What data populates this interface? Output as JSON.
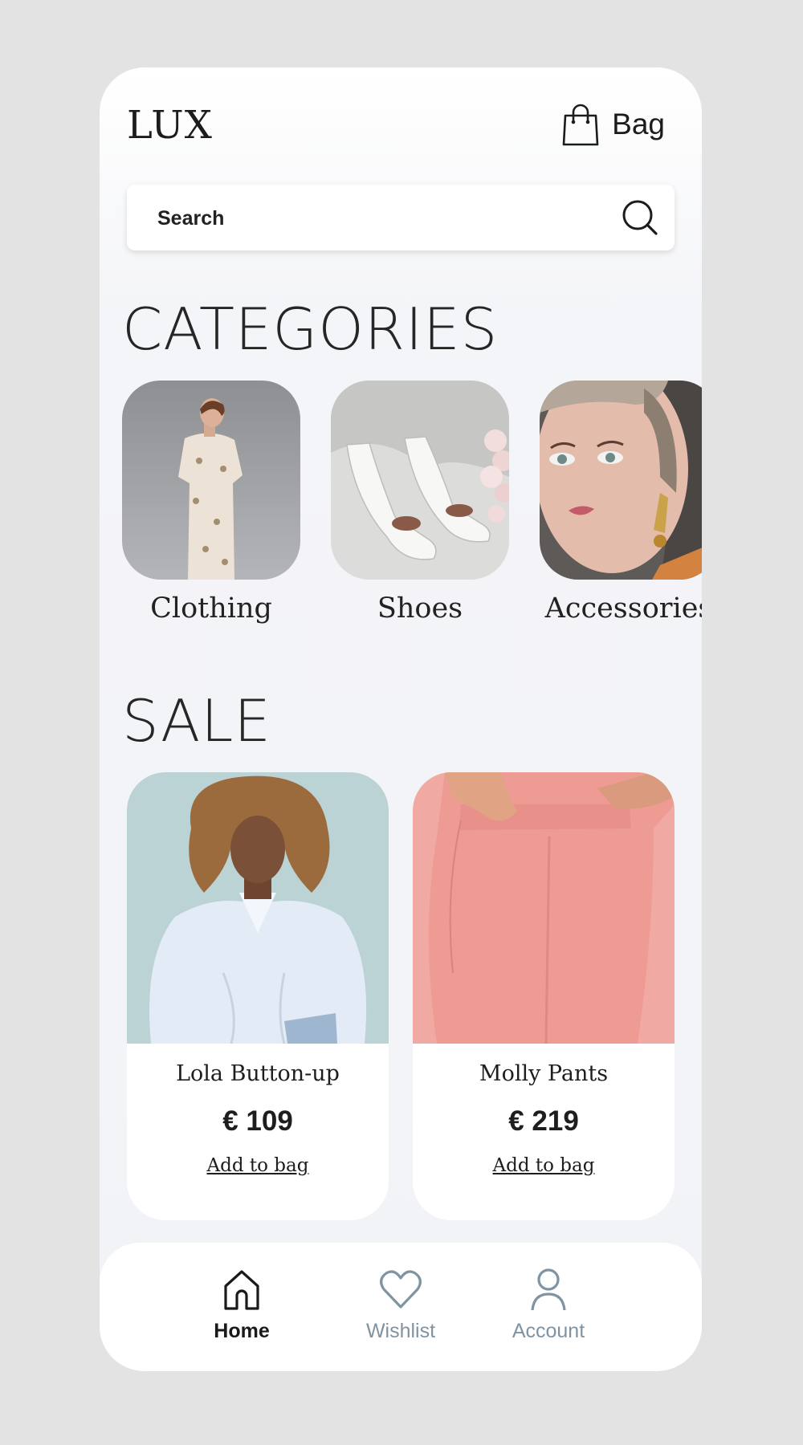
{
  "header": {
    "logo": "LUX",
    "bag_label": "Bag"
  },
  "search": {
    "placeholder": "Search"
  },
  "categories": {
    "title": "CATEGORIES",
    "items": [
      {
        "label": "Clothing"
      },
      {
        "label": "Shoes"
      },
      {
        "label": "Accessories"
      }
    ]
  },
  "sale": {
    "title": "SALE",
    "items": [
      {
        "name": "Lola Button-up",
        "price": "€ 109",
        "action": "Add to bag"
      },
      {
        "name": "Molly Pants",
        "price": "€ 219",
        "action": "Add to bag"
      }
    ]
  },
  "nav": {
    "items": [
      {
        "label": "Home",
        "active": true
      },
      {
        "label": "Wishlist"
      },
      {
        "label": "Account"
      }
    ]
  },
  "colors": {
    "background": "#e3e3e4",
    "screen": "#f2f3f7",
    "text": "#1c1c1c",
    "nav_inactive": "#7f94a3"
  }
}
